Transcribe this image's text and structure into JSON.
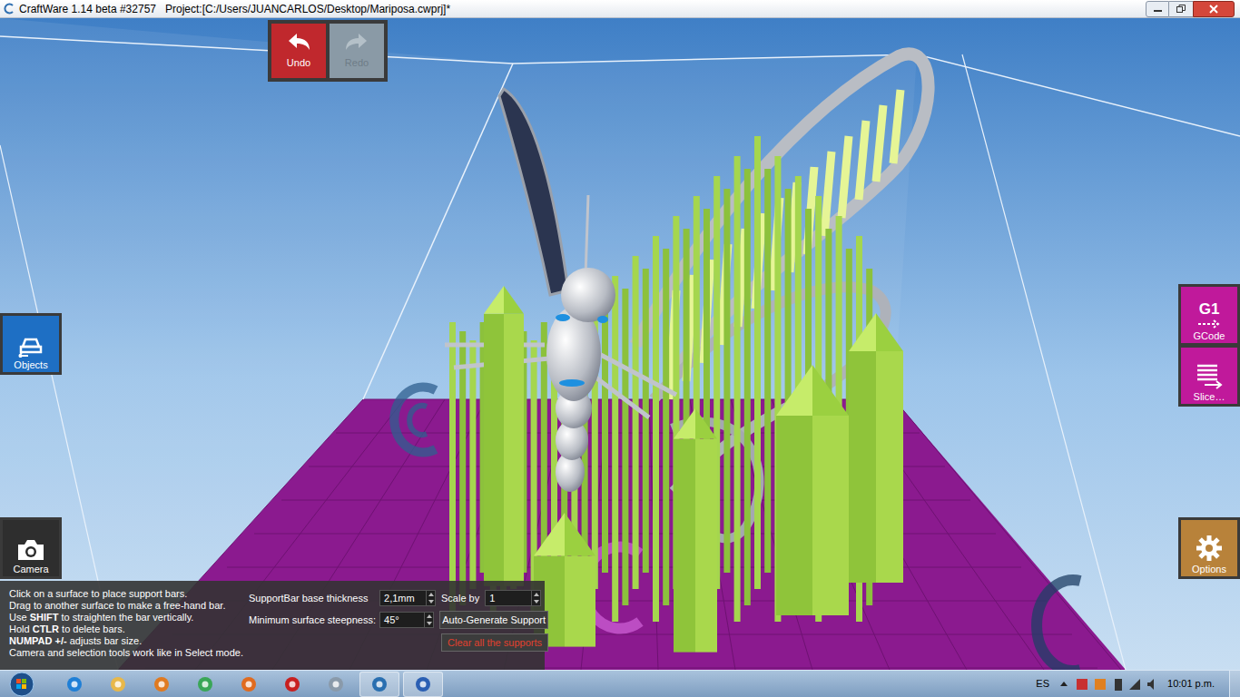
{
  "window": {
    "title": "CraftWare 1.14 beta #32757   Project:[C:/Users/JUANCARLOS/Desktop/Mariposa.cwprj]*"
  },
  "toolbar": [
    {
      "label": "Undo",
      "disabled": false
    },
    {
      "label": "Redo",
      "disabled": true
    }
  ],
  "left_buttons": [
    {
      "label": "Objects",
      "kind": "objects"
    },
    {
      "label": "Camera",
      "kind": "camera"
    }
  ],
  "right_buttons": [
    {
      "label": "GCode",
      "badge": "G1",
      "kind": "gcode"
    },
    {
      "label": "Slice…",
      "badge": "",
      "kind": "slice"
    },
    {
      "label": "Options",
      "badge": "",
      "kind": "options"
    }
  ],
  "help_lines": [
    {
      "segments": [
        {
          "text": "Click on a surface to place support bars.",
          "bold": false
        }
      ]
    },
    {
      "segments": [
        {
          "text": "Drag to another surface to make a free-hand bar.",
          "bold": false
        }
      ]
    },
    {
      "segments": [
        {
          "text": "Use ",
          "bold": false
        },
        {
          "text": "SHIFT",
          "bold": true
        },
        {
          "text": " to straighten the bar vertically.",
          "bold": false
        }
      ]
    },
    {
      "segments": [
        {
          "text": "Hold ",
          "bold": false
        },
        {
          "text": "CTLR",
          "bold": true
        },
        {
          "text": " to delete bars.",
          "bold": false
        }
      ]
    },
    {
      "segments": [
        {
          "text": "NUMPAD +/-",
          "bold": true
        },
        {
          "text": " adjusts bar size.",
          "bold": false
        }
      ]
    },
    {
      "segments": [
        {
          "text": "Camera and selection tools work like in Select mode.",
          "bold": false
        }
      ]
    }
  ],
  "fields": [
    {
      "label": "SupportBar base thickness",
      "value": "2,1mm"
    },
    {
      "label": "Scale by",
      "value": "1"
    },
    {
      "label": "Minimum surface steepness:",
      "value": "45°"
    }
  ],
  "actions": [
    {
      "label": "Auto-Generate Support",
      "kind": "normal"
    },
    {
      "label": "Clear all the supports",
      "kind": "danger"
    }
  ],
  "taskbar": {
    "language": "ES",
    "time": "10:01 p.m."
  }
}
